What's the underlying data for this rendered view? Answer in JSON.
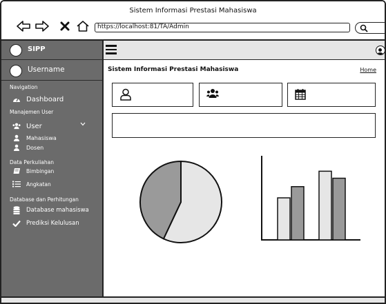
{
  "window": {
    "title": "Sistem Informasi Prestasi Mahasiswa"
  },
  "browser": {
    "url": "https://localhost:81/TA/Admin",
    "icons": [
      "back-icon",
      "forward-icon",
      "close-icon",
      "home-icon",
      "search-icon"
    ]
  },
  "sidebar": {
    "brand": "SIPP",
    "user": "Username",
    "sections": {
      "navigation": "Navigation",
      "manajemen": "Manajemen User",
      "data": "Data Perkuliahan",
      "database": "Database dan Perhitungan"
    },
    "items": {
      "dashboard": "Dashboard",
      "user": "User",
      "mahasiswa": "Mahasiswa",
      "dosen": "Dosen",
      "bimbingan": "Bimbingan",
      "angkatan": "Angkatan",
      "db_mahasiswa": "Database mahasiswa",
      "prediksi": "Prediksi Kelulusan"
    }
  },
  "main": {
    "title": "Sistem Informasi Prestasi Mahasiswa",
    "breadcrumb": "Home",
    "cards": [
      "user-icon",
      "group-icon",
      "calendar-icon"
    ]
  },
  "chart_data": [
    {
      "type": "pie",
      "values": [
        57,
        43
      ],
      "colors": [
        "#e6e6e6",
        "#9a9a9a"
      ]
    },
    {
      "type": "bar",
      "categories": [
        "",
        ""
      ],
      "series": [
        {
          "values": [
            60,
            98
          ],
          "color": "#e6e6e6"
        },
        {
          "values": [
            76,
            88
          ],
          "color": "#9a9a9a"
        }
      ],
      "ylim": [
        0,
        120
      ]
    }
  ]
}
